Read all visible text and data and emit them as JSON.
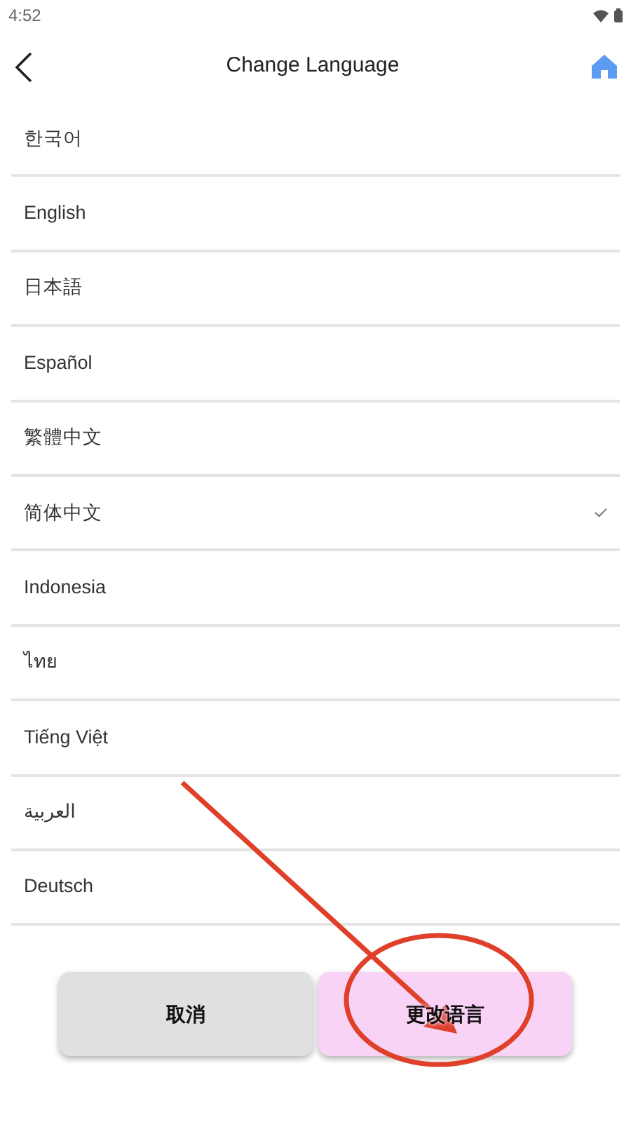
{
  "status_bar": {
    "time": "4:52"
  },
  "header": {
    "title": "Change Language"
  },
  "languages": [
    {
      "label": "한국어",
      "selected": false
    },
    {
      "label": "English",
      "selected": false
    },
    {
      "label": "日本語",
      "selected": false
    },
    {
      "label": "Español",
      "selected": false
    },
    {
      "label": "繁體中文",
      "selected": false
    },
    {
      "label": "简体中文",
      "selected": true
    },
    {
      "label": "Indonesia",
      "selected": false
    },
    {
      "label": "ไทย",
      "selected": false
    },
    {
      "label": "Tiếng Việt",
      "selected": false
    },
    {
      "label": "العربية",
      "selected": false
    },
    {
      "label": "Deutsch",
      "selected": false
    }
  ],
  "buttons": [
    {
      "label": "取消",
      "kind": "cancel"
    },
    {
      "label": "更改语言",
      "kind": "confirm"
    }
  ]
}
